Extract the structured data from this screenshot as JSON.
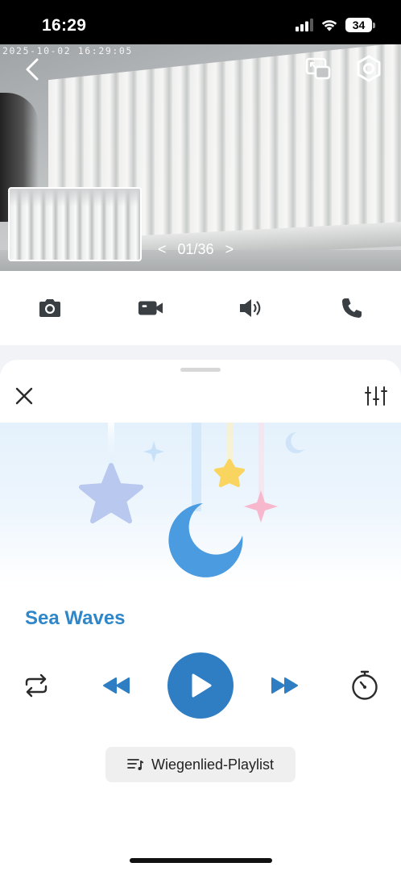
{
  "status_bar": {
    "time": "16:29",
    "battery": "34",
    "icons": [
      "signal-icon",
      "wifi-icon",
      "battery-icon"
    ]
  },
  "video": {
    "timestamp": "2025-10-02 16:29:05",
    "pager": {
      "current": "01/36",
      "prev": "<",
      "next": ">"
    },
    "icons": [
      "back-icon",
      "picture-in-picture-icon",
      "settings-icon"
    ]
  },
  "actions": {
    "items": [
      {
        "name": "snapshot",
        "icon": "camera-icon"
      },
      {
        "name": "record",
        "icon": "video-camera-icon"
      },
      {
        "name": "speaker",
        "icon": "speaker-icon"
      },
      {
        "name": "call",
        "icon": "phone-icon"
      }
    ]
  },
  "player": {
    "track_title": "Sea Waves",
    "playlist_label": "Wiegenlied-Playlist",
    "controls": [
      "repeat-icon",
      "rewind-icon",
      "play-icon",
      "fast-forward-icon",
      "timer-icon"
    ]
  },
  "colors": {
    "accent": "#2f7ec4",
    "title": "#2f86c8",
    "icon_dark": "#3a3f44",
    "moon": "#4a9be0",
    "star_blue": "#b8c8ef",
    "star_yellow": "#f9d560",
    "star_pink": "#f7b7cd"
  }
}
